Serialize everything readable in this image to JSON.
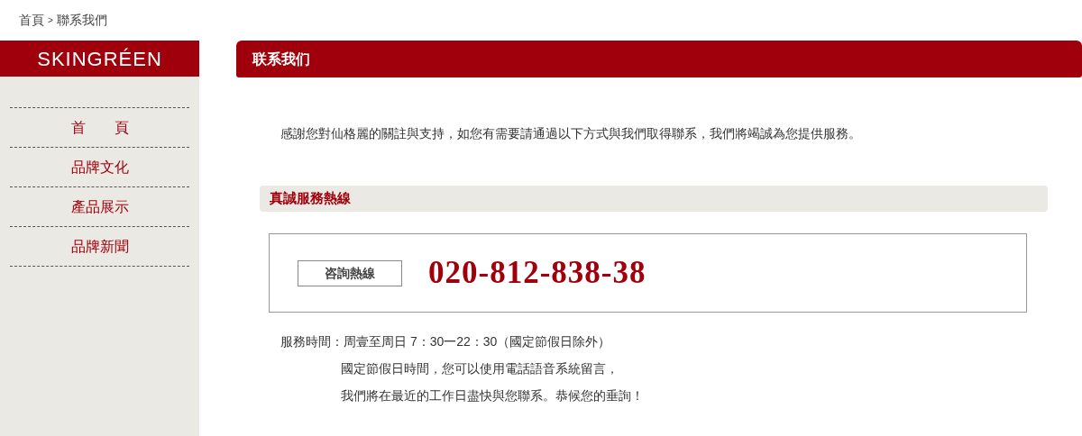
{
  "breadcrumb": {
    "items": [
      {
        "label": "首頁",
        "kind": "link"
      },
      {
        "label": ">",
        "kind": "separator"
      },
      {
        "label": "聯系我們",
        "kind": "current"
      }
    ]
  },
  "sidebar": {
    "logo": "SKINGRÉEN",
    "items": [
      {
        "label": "首　　頁"
      },
      {
        "label": "品牌文化"
      },
      {
        "label": "產品展示"
      },
      {
        "label": "品牌新聞"
      }
    ]
  },
  "main": {
    "title": "联系我们",
    "intro": "感謝您對仙格麗的關註與支持，如您有需要請通過以下方式與我們取得聯系，我們將竭誠為您提供服務。",
    "section_title": "真誠服務熱線",
    "hotline_label": "咨詢熱線",
    "hotline_number": "020-812-838-38",
    "hours_label": "服務時間：",
    "hours_lines": [
      "周壹至周日 7：30一22：30（國定節假日除外）",
      "國定節假日時間，您可以使用電話語音系統留言，",
      "我們將在最近的工作日盡快與您聯系。恭候您的垂詢！"
    ]
  }
}
